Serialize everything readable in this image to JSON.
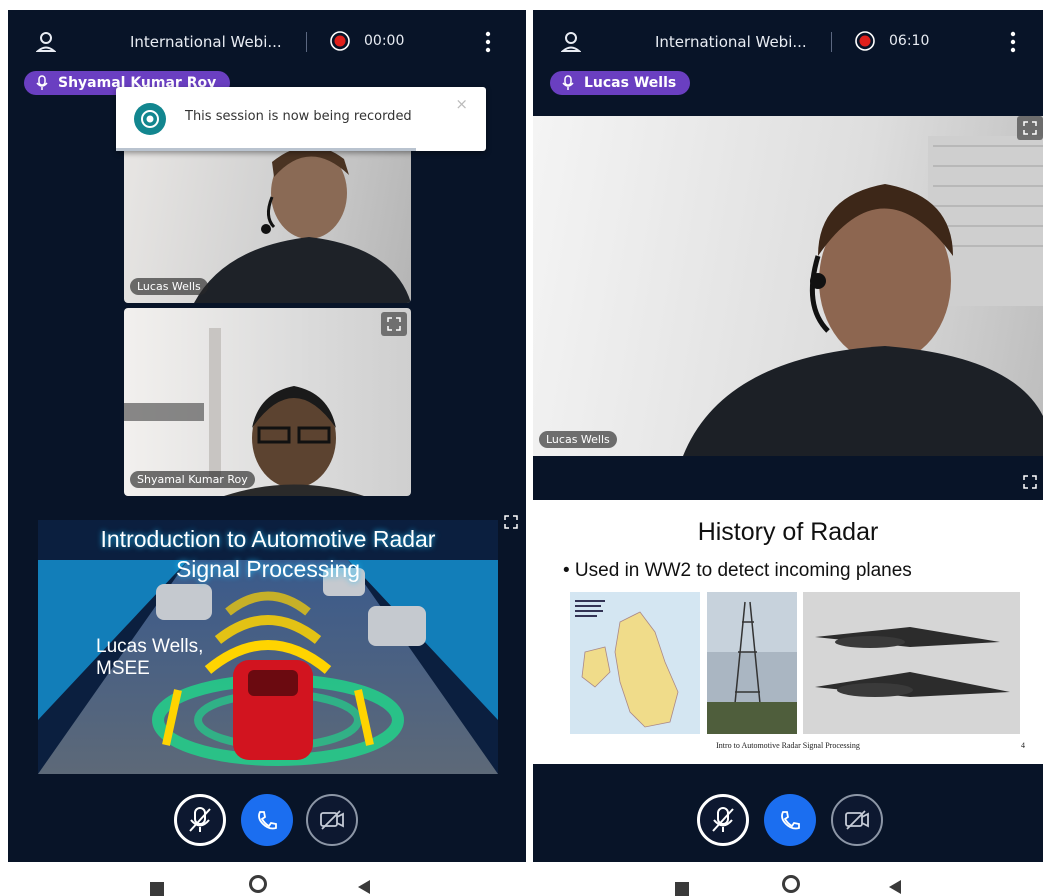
{
  "left_screen": {
    "title": "International Webi...",
    "timer": "00:00",
    "speaker": "Shyamal Kumar Roy",
    "toast": {
      "message": "This session is now being recorded",
      "close": "×"
    },
    "tiles": [
      {
        "name": "Lucas Wells"
      },
      {
        "name": "Shyamal Kumar Roy"
      }
    ],
    "slide": {
      "title_line1": "Introduction to Automotive Radar",
      "title_line2": "Signal Processing",
      "author_line1": "Lucas Wells,",
      "author_line2": "MSEE"
    }
  },
  "right_screen": {
    "title": "International Webi...",
    "timer": "06:10",
    "speaker": "Lucas Wells",
    "tile_name": "Lucas Wells",
    "slide": {
      "heading": "History of Radar",
      "bullet": "• Used in WW2 to detect incoming planes",
      "footer": "Intro to Automotive Radar Signal Processing",
      "page": "4"
    }
  },
  "colors": {
    "background": "#081428",
    "speaker_pill": "#6a3fc1",
    "record": "#e0201c",
    "call_button": "#1b6ef0",
    "toast_icon": "#12868f"
  },
  "icons": [
    "user-icon",
    "record-icon",
    "more-vert-icon",
    "mic-icon",
    "mic-off-icon",
    "phone-icon",
    "camera-off-icon",
    "expand-icon",
    "close-icon"
  ]
}
